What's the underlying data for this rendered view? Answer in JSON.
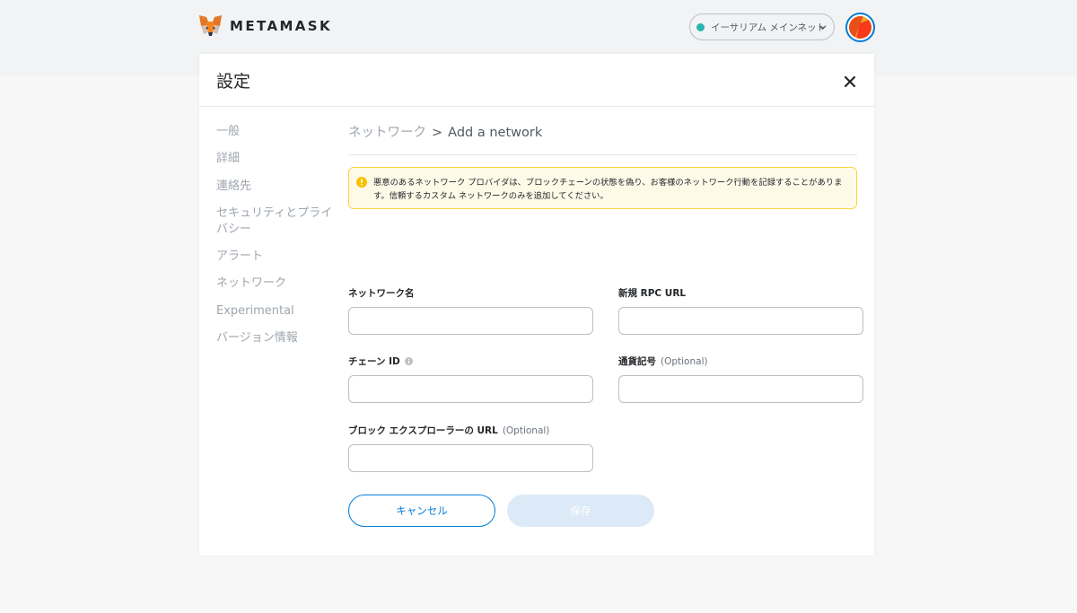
{
  "app": {
    "brand": "METAMASK",
    "network": "イーサリアム メインネット",
    "colors": {
      "accent": "#037dd6",
      "network_dot": "#29b6af",
      "warning_border": "#ffd33d"
    }
  },
  "settings": {
    "title": "設定",
    "close_icon": "close-icon",
    "sidebar": [
      "一般",
      "詳細",
      "連絡先",
      "セキュリティとプライバシー",
      "アラート",
      "ネットワーク",
      "Experimental",
      "バージョン情報"
    ]
  },
  "breadcrumb": {
    "parent": "ネットワーク",
    "separator": ">",
    "current": "Add a network"
  },
  "warning": {
    "text": "悪意のあるネットワーク プロバイダは、ブロックチェーンの状態を偽り、お客様のネットワーク行動を記録することがあります。信頼するカスタム ネットワークのみを追加してください。"
  },
  "form": {
    "network_name": {
      "label": "ネットワーク名",
      "value": ""
    },
    "rpc_url": {
      "label": "新規 RPC URL",
      "value": ""
    },
    "chain_id": {
      "label": "チェーン ID",
      "value": ""
    },
    "currency_symbol": {
      "label": "通貨記号",
      "optional": "(Optional)",
      "value": ""
    },
    "block_explorer": {
      "label": "ブロック エクスプローラーの URL",
      "optional": "(Optional)",
      "value": ""
    }
  },
  "buttons": {
    "cancel": "キャンセル",
    "save": "保存"
  }
}
